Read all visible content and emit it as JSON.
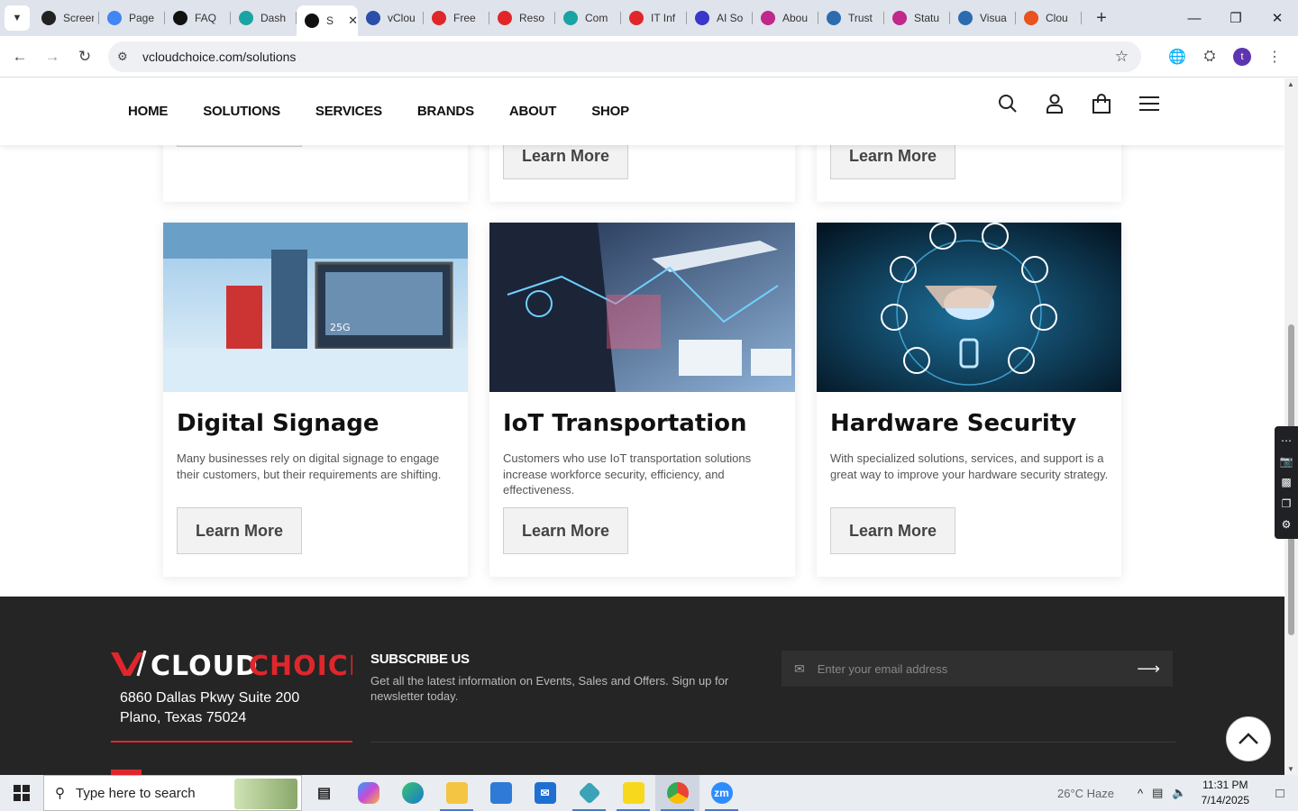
{
  "browser": {
    "tabs": [
      {
        "title": "Screen",
        "color": "#222"
      },
      {
        "title": "Page",
        "color": "#4285f4"
      },
      {
        "title": "FAQ",
        "color": "#111"
      },
      {
        "title": "Dash",
        "color": "#1aa3a3"
      },
      {
        "title": "S",
        "color": "#111",
        "active": true
      },
      {
        "title": "vClou",
        "color": "#2b4fa8"
      },
      {
        "title": "Free",
        "color": "#e0262b"
      },
      {
        "title": "Reso",
        "color": "#e0262b"
      },
      {
        "title": "Com",
        "color": "#1aa3a3"
      },
      {
        "title": "IT Inf",
        "color": "#e0262b"
      },
      {
        "title": "AI So",
        "color": "#3a36c9"
      },
      {
        "title": "Abou",
        "color": "#c0288a"
      },
      {
        "title": "Trust",
        "color": "#2b6cb0"
      },
      {
        "title": "Statu",
        "color": "#c0288a"
      },
      {
        "title": "Visua",
        "color": "#2b6cb0"
      },
      {
        "title": "Clou",
        "color": "#e8531f"
      }
    ],
    "url": "vcloudchoice.com/solutions",
    "avatar_letter": "t"
  },
  "site": {
    "nav": [
      "HOME",
      "SOLUTIONS",
      "SERVICES",
      "BRANDS",
      "ABOUT",
      "SHOP"
    ],
    "learn_more": "Learn More",
    "cards": [
      {
        "title": "Digital Signage",
        "desc": "Many businesses rely on digital signage to engage their customers, but their requirements are shifting."
      },
      {
        "title": "IoT Transportation",
        "desc": "Customers who use IoT transportation solutions increase workforce security, efficiency, and effectiveness."
      },
      {
        "title": "Hardware Security",
        "desc": "With specialized solutions, services, and support is a great way to improve your hardware security strategy."
      }
    ],
    "footer": {
      "logo_text_1": "CLOUD",
      "logo_text_2": "CHOICE",
      "address_line1": "6860 Dallas Pkwy Suite 200",
      "address_line2": "Plano, Texas 75024",
      "subscribe_title": "SUBSCRIBE US",
      "subscribe_text": "Get all the latest information on Events, Sales and Offers. Sign up for newsletter today.",
      "email_placeholder": "Enter your email address"
    }
  },
  "taskbar": {
    "search_placeholder": "Type here to search",
    "weather": "26°C  Haze",
    "time": "11:31 PM",
    "date": "7/14/2025"
  },
  "colors": {
    "brand_red": "#e0262b",
    "footer_bg": "#252525"
  }
}
